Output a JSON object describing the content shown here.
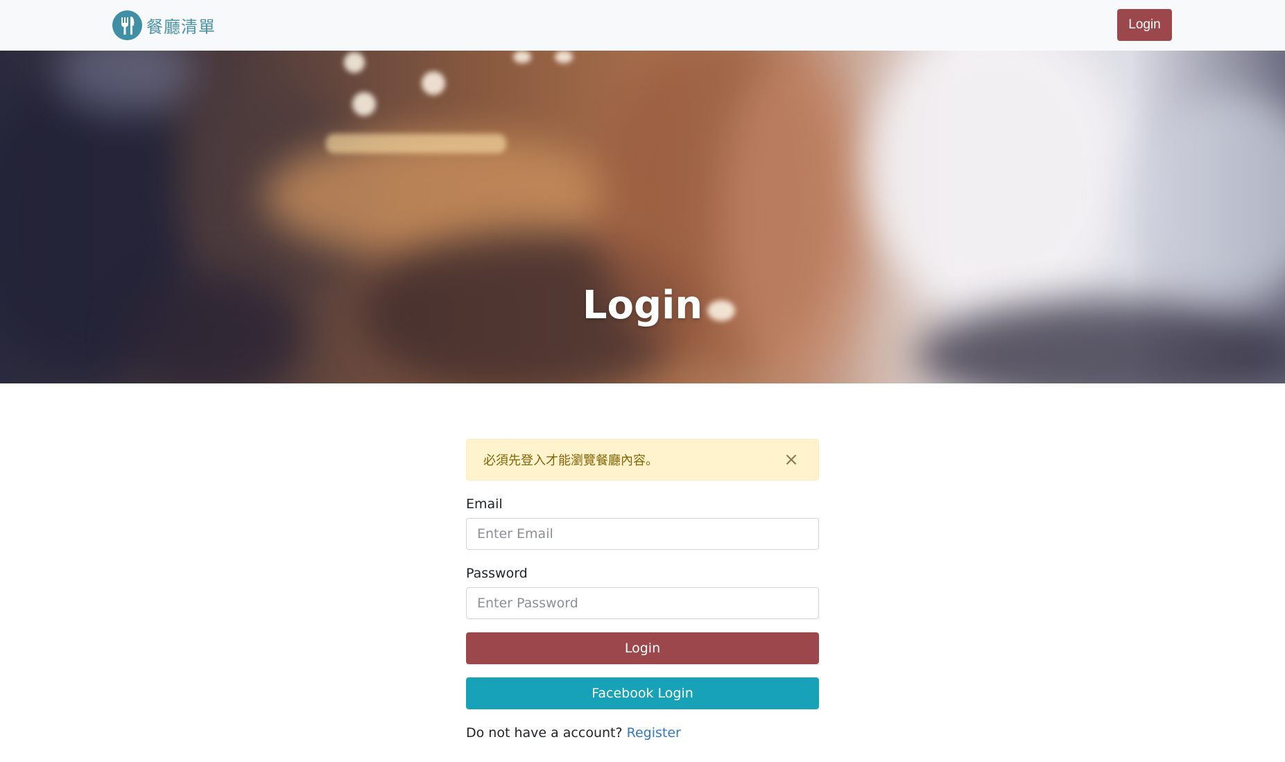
{
  "navbar": {
    "brand_text": "餐廳清單",
    "brand_icon": "fork-knife-icon",
    "login_label": "Login"
  },
  "hero": {
    "title": "Login"
  },
  "alert": {
    "message": "必須先登入才能瀏覽餐廳內容。",
    "close_symbol": "×"
  },
  "form": {
    "email_label": "Email",
    "email_placeholder": "Enter Email",
    "email_value": "",
    "password_label": "Password",
    "password_placeholder": "Enter Password",
    "password_value": "",
    "login_button": "Login",
    "facebook_button": "Facebook Login",
    "register_prompt": "Do not have a account?",
    "register_link": "Register"
  },
  "colors": {
    "brand": "#4a93a8",
    "primary_button": "#9b474b",
    "facebook_button": "#17a2b8",
    "alert_bg": "#fff3cd",
    "alert_text": "#856404",
    "link": "#2f79c9"
  }
}
